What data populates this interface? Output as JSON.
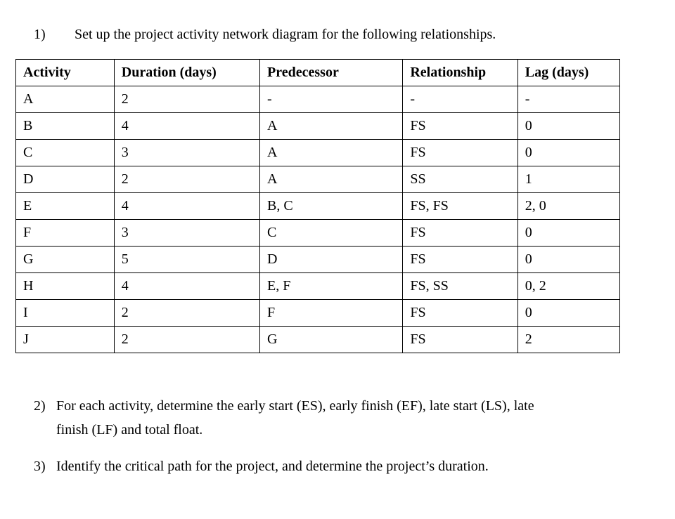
{
  "questions": {
    "q1": {
      "number": "1)",
      "text": "Set up the project activity network diagram for the following relationships."
    },
    "q2": {
      "number": "2)",
      "text_line1": "For each activity, determine the early start (ES), early finish (EF), late start (LS), late",
      "text_line2": "finish (LF) and total float."
    },
    "q3": {
      "number": "3)",
      "text": "Identify the critical path for the project, and determine the project’s duration."
    }
  },
  "table": {
    "headers": {
      "activity": "Activity",
      "duration": "Duration (days)",
      "predecessor": "Predecessor",
      "relationship": "Relationship",
      "lag": "Lag (days)"
    },
    "rows": [
      {
        "activity": "A",
        "duration": "2",
        "predecessor": "-",
        "relationship": "-",
        "lag": "-"
      },
      {
        "activity": "B",
        "duration": "4",
        "predecessor": "A",
        "relationship": "FS",
        "lag": "0"
      },
      {
        "activity": "C",
        "duration": "3",
        "predecessor": "A",
        "relationship": "FS",
        "lag": "0"
      },
      {
        "activity": "D",
        "duration": "2",
        "predecessor": "A",
        "relationship": "SS",
        "lag": "1"
      },
      {
        "activity": "E",
        "duration": "4",
        "predecessor": "B, C",
        "relationship": "FS, FS",
        "lag": "2, 0"
      },
      {
        "activity": "F",
        "duration": "3",
        "predecessor": "C",
        "relationship": "FS",
        "lag": "0"
      },
      {
        "activity": "G",
        "duration": "5",
        "predecessor": "D",
        "relationship": "FS",
        "lag": "0"
      },
      {
        "activity": "H",
        "duration": "4",
        "predecessor": "E, F",
        "relationship": "FS, SS",
        "lag": "0, 2"
      },
      {
        "activity": "I",
        "duration": "2",
        "predecessor": "F",
        "relationship": "FS",
        "lag": "0"
      },
      {
        "activity": "J",
        "duration": "2",
        "predecessor": "G",
        "relationship": "FS",
        "lag": "2"
      }
    ]
  }
}
